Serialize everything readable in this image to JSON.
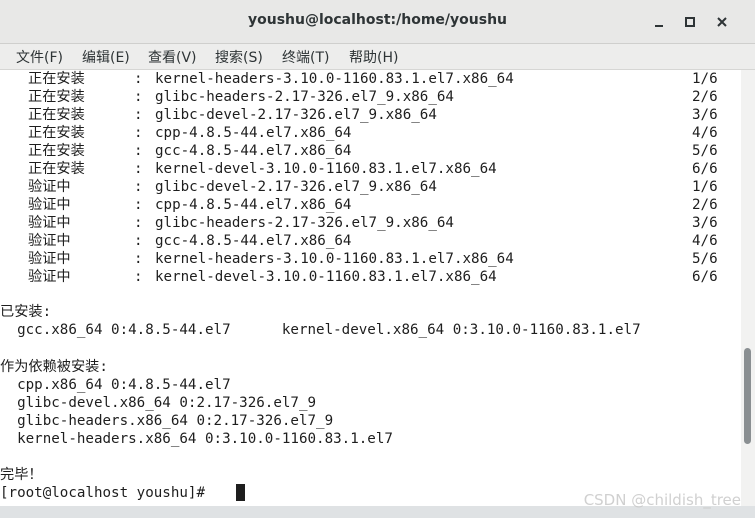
{
  "window": {
    "title": "youshu@localhost:/home/youshu"
  },
  "menu": [
    "文件(F)",
    "编辑(E)",
    "查看(V)",
    "搜索(S)",
    "终端(T)",
    "帮助(H)"
  ],
  "install_rows": [
    {
      "status": "正在安装",
      "sep": ":",
      "pkg": "kernel-headers-3.10.0-1160.83.1.el7.x86_64",
      "progress": "1/6"
    },
    {
      "status": "正在安装",
      "sep": ":",
      "pkg": "glibc-headers-2.17-326.el7_9.x86_64",
      "progress": "2/6"
    },
    {
      "status": "正在安装",
      "sep": ":",
      "pkg": "glibc-devel-2.17-326.el7_9.x86_64",
      "progress": "3/6"
    },
    {
      "status": "正在安装",
      "sep": ":",
      "pkg": "cpp-4.8.5-44.el7.x86_64",
      "progress": "4/6"
    },
    {
      "status": "正在安装",
      "sep": ":",
      "pkg": "gcc-4.8.5-44.el7.x86_64",
      "progress": "5/6"
    },
    {
      "status": "正在安装",
      "sep": ":",
      "pkg": "kernel-devel-3.10.0-1160.83.1.el7.x86_64",
      "progress": "6/6"
    },
    {
      "status": "验证中",
      "sep": ":",
      "pkg": "glibc-devel-2.17-326.el7_9.x86_64",
      "progress": "1/6"
    },
    {
      "status": "验证中",
      "sep": ":",
      "pkg": "cpp-4.8.5-44.el7.x86_64",
      "progress": "2/6"
    },
    {
      "status": "验证中",
      "sep": ":",
      "pkg": "glibc-headers-2.17-326.el7_9.x86_64",
      "progress": "3/6"
    },
    {
      "status": "验证中",
      "sep": ":",
      "pkg": "gcc-4.8.5-44.el7.x86_64",
      "progress": "4/6"
    },
    {
      "status": "验证中",
      "sep": ":",
      "pkg": "kernel-headers-3.10.0-1160.83.1.el7.x86_64",
      "progress": "5/6"
    },
    {
      "status": "验证中",
      "sep": ":",
      "pkg": "kernel-devel-3.10.0-1160.83.1.el7.x86_64",
      "progress": "6/6"
    }
  ],
  "installed": {
    "heading": "已安装:",
    "line": "  gcc.x86_64 0:4.8.5-44.el7      kernel-devel.x86_64 0:3.10.0-1160.83.1.el7"
  },
  "deps": {
    "heading": "作为依赖被安装:",
    "lines": [
      "  cpp.x86_64 0:4.8.5-44.el7",
      "  glibc-devel.x86_64 0:2.17-326.el7_9",
      "  glibc-headers.x86_64 0:2.17-326.el7_9",
      "  kernel-headers.x86_64 0:3.10.0-1160.83.1.el7"
    ]
  },
  "done": "完毕！",
  "prompt": "[root@localhost youshu]# ",
  "watermark": "CSDN @childish_tree",
  "scrollbar": {
    "position": 0.82,
    "visible_fraction": 0.22
  }
}
